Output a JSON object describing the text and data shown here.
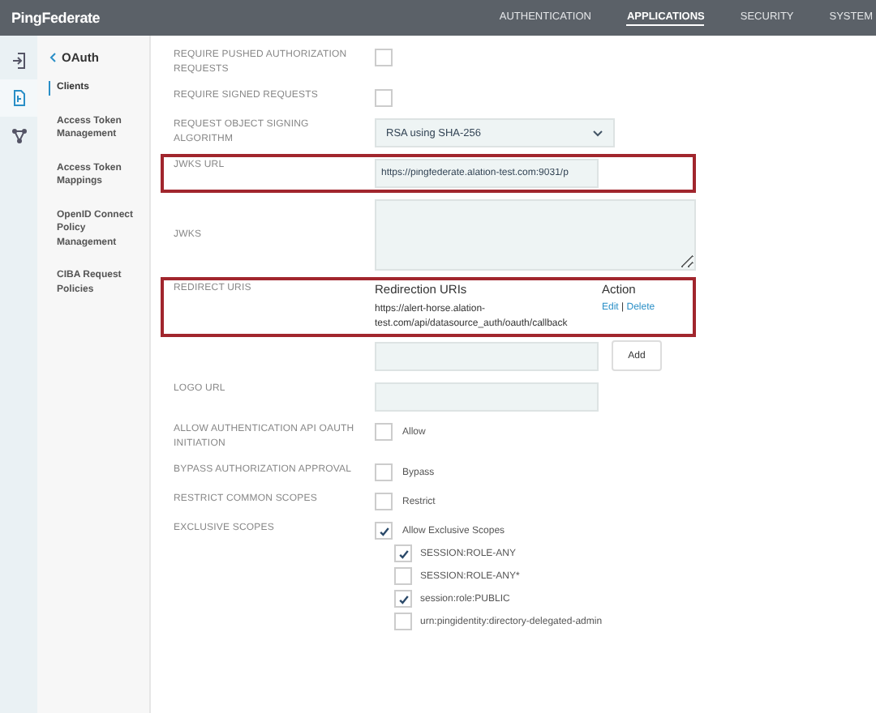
{
  "header": {
    "logo": "PingFederate",
    "nav": [
      {
        "label": "AUTHENTICATION",
        "selected": false
      },
      {
        "label": "APPLICATIONS",
        "selected": true
      },
      {
        "label": "SECURITY",
        "selected": false
      },
      {
        "label": "SYSTEM",
        "selected": false
      }
    ]
  },
  "icon_rail": [
    {
      "kind": "login",
      "selected": false
    },
    {
      "kind": "app",
      "selected": true
    },
    {
      "kind": "network",
      "selected": false
    }
  ],
  "sidebar": {
    "back": "OAuth",
    "items": [
      {
        "label": "Clients",
        "selected": true
      },
      {
        "label": "Access Token Management",
        "selected": false
      },
      {
        "label": "Access Token Mappings",
        "selected": false
      },
      {
        "label": "OpenID Connect Policy Management",
        "selected": false
      },
      {
        "label": "CIBA Request Policies",
        "selected": false
      }
    ]
  },
  "fields": [
    {
      "kind": "checkbox",
      "label": "REQUIRE PUSHED AUTHORIZATION REQUESTS",
      "checked": false,
      "highlighted": false
    },
    {
      "kind": "checkbox",
      "label": "REQUIRE SIGNED REQUESTS",
      "checked": false,
      "highlighted": false
    },
    {
      "kind": "select",
      "label": "REQUEST OBJECT SIGNING ALGORITHM",
      "value": "RSA using SHA-256",
      "highlighted": false
    },
    {
      "kind": "text",
      "label": "JWKS URL",
      "value": "https://pingfederate.alation-test.com:9031/p",
      "highlighted": true
    },
    {
      "kind": "textarea",
      "label": "JWKS",
      "highlighted": false
    },
    {
      "kind": "table",
      "label": "REDIRECT URIS",
      "columns": [
        "Redirection URIs",
        "Action"
      ],
      "rows": [
        {
          "uri": "https://alert-horse.alation-test.com/api/datasource_auth/oauth/callback",
          "edit": "Edit",
          "separator": "|",
          "delete": "Delete"
        }
      ],
      "add_button": "Add",
      "highlighted": true
    },
    {
      "kind": "text",
      "label": "LOGO URL",
      "highlighted": false
    },
    {
      "kind": "checkbox",
      "label": "ALLOW AUTHENTICATION API OAUTH INITIATION",
      "option": "Allow",
      "checked": false,
      "highlighted": false
    },
    {
      "kind": "checkbox",
      "label": "BYPASS AUTHORIZATION APPROVAL",
      "option": "Bypass",
      "checked": false,
      "highlighted": false
    },
    {
      "kind": "checkbox",
      "label": "RESTRICT COMMON SCOPES",
      "option": "Restrict",
      "checked": false,
      "highlighted": false
    },
    {
      "kind": "checkbox",
      "label": "EXCLUSIVE SCOPES",
      "option": "Allow Exclusive Scopes",
      "checked": true,
      "highlighted": false,
      "children": [
        {
          "label": "SESSION:ROLE-ANY",
          "checked": true
        },
        {
          "label": "SESSION:ROLE-ANY*",
          "checked": false
        },
        {
          "label": "session:role:PUBLIC",
          "checked": true
        },
        {
          "label": "urn:pingidentity:directory-delegated-admin",
          "checked": false
        }
      ]
    }
  ]
}
